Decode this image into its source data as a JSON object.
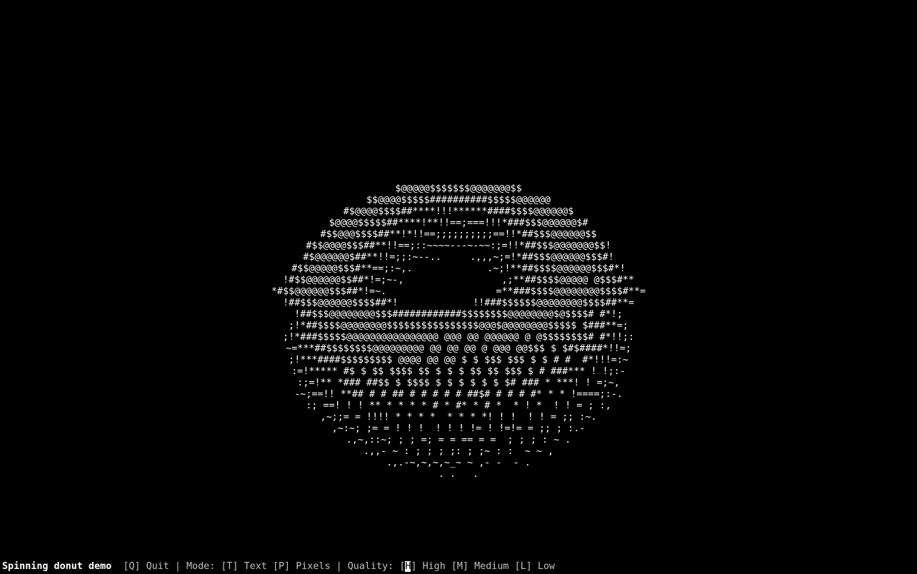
{
  "app": {
    "title": "Spinning donut demo"
  },
  "donut": {
    "rows": [
      "$@@@@@$$$$$$$@@@@@@@$$",
      "$$@@@@$$$$$##########$$$$$@@@@@@",
      "#$@@@@$$$$##****!!!******####$$$$@@@@@@$",
      "$@@@@$$$$$##****!**!!==;===!!!*###$$$@@@@@@$#",
      "#$$@@@$$$$##**!*!!==;;;;;;;;;;==!!*##$$$@@@@@@$$",
      "#$$@@@@$$$##**!!==;::~~~~---~-~~:;=!!*##$$$@@@@@@@$$!",
      "#$@@@@@@$##**!!=;;:~--..     .,,,~;=!*##$$$@@@@@@$$$#!",
      "#$$@@@@@$$$#**==;:~,.             .~;!**##$$$$@@@@@@$$$#*!",
      "!#$$@@@@@@$$##*!=;~-,                 ,;**##$$$$@@@@@ @$$$#**",
      "*#$$@@@@@@$$$##*!=~.                   =**###$$$$@@@@@@@@$$$$#**=",
      "!##$$$@@@@@@$$$$##*!             !!###$$$$$$@@@@@@@@$$$$##**=",
      "!##$$$@@@@@@@@$$$############$$$$$$$$@@@@@@@@$@$$$$# #*!;",
      ";!*##$$$$@@@@@@@@$$$$$$$$$$$$$$$$@@@$@@@@@@@@$$$$$ $###**=;",
      ";!*###$$$$$@@@@@@@@@@@@@@@@ @@@ @@ @@@@@@ @ @$$$$$$$$# #*!!;:",
      "~=***##$$$$$$$$@@@@@@@@@ @@ @@ @@ @ @@@ @@$$$ $ $#$####*!!=;",
      ";!***####$$$$$$$$$ @@@@ @@ @@ $ $ $$$ $$$ $ $ # #  #*!!!=:~",
      ":=!***** #$ $ $$ $$$$ $$ $ $ $ $$ $$ $$$ $ # ###*** ! !;:-",
      ":;=!** *### ##$$ $ $$$$ $ $ $ $ $ $ $# ### * ***! ! =;~,",
      "-~;==!! **## # # ## # # # # # ##$# # # # #* * * !====;:-.",
      ":; ==! ! ! ** * * * * # * #* * # *  * ! *  ! ! = ; :,",
      ",~;;= = !!!! * * * *  * * * *! ! !  ! ! = ;; :~.",
      ",~:~; ;= = ! ! !  ! ! ! != ! !=!= = ;; ; :.-",
      ".,~,::~; ; ; =; = = == = =  ; ; ; : ~ .",
      ".,,- ~ : ; ; ; ;: ; ;~ : :  ~ ~ ,",
      ".,.-~,~,~,~_~ ~ ,- -  - .",
      ". .   ."
    ]
  },
  "statusbar": {
    "title": "Spinning donut demo",
    "quit_key": "[Q]",
    "quit_label": "Quit",
    "separator": "|",
    "mode_label": "Mode:",
    "text_key": "[T]",
    "text_label": "Text",
    "pixels_key": "[P]",
    "pixels_label": "Pixels",
    "quality_label": "Quality:",
    "high_key_open": "[",
    "high_key_letter": "H",
    "high_key_close": "]",
    "high_label": "High",
    "medium_key": "[M]",
    "medium_label": "Medium",
    "low_key": "[L]",
    "low_label": "Low"
  },
  "colors": {
    "background": "#000000",
    "foreground": "#ffffff",
    "status_text": "#c0c0c0"
  }
}
